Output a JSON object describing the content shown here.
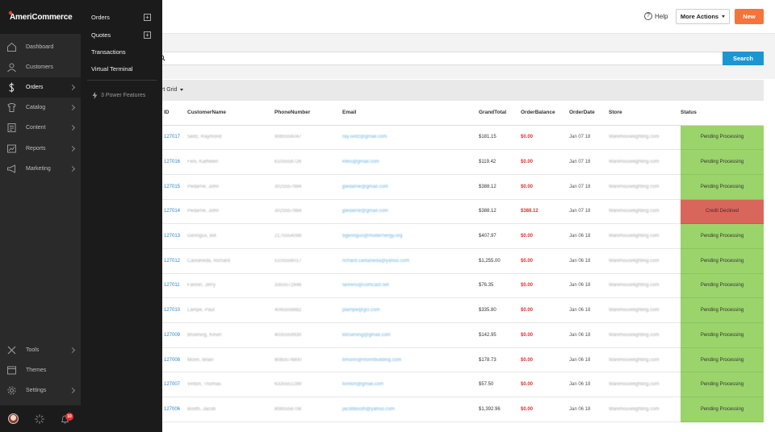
{
  "header": {
    "help_label": "Help",
    "help_glyph": "?",
    "more_actions_label": "More Actions",
    "new_label": "New"
  },
  "search": {
    "placeholder": "",
    "button_label": "Search"
  },
  "grid_bar": {
    "label": "rt Grid"
  },
  "table": {
    "columns": [
      "ID",
      "CustomerName",
      "PhoneNumber",
      "Email",
      "GrandTotal",
      "OrderBalance",
      "OrderDate",
      "Store",
      "Status"
    ],
    "rows": [
      {
        "id": "127017",
        "name": "Seitz, Raymond",
        "phone": "9085556047",
        "email": "ray.seitz@gmail.com",
        "grand_total": "$181.15",
        "balance": "$0.00",
        "date": "Jan 07 18",
        "store": "Warehouselighting.com",
        "status": "Pending Processing"
      },
      {
        "id": "127016",
        "name": "Fels, Kathleen",
        "phone": "6105558726",
        "email": "kfels@gmail.com",
        "grand_total": "$119.42",
        "balance": "$0.00",
        "date": "Jan 07 18",
        "store": "Warehouselighting.com",
        "status": "Pending Processing"
      },
      {
        "id": "127015",
        "name": "Pedarne, John",
        "phone": "3025557984",
        "email": "jpedarne@gmail.com",
        "grand_total": "$388.12",
        "balance": "$0.00",
        "date": "Jan 07 18",
        "store": "Warehouselighting.com",
        "status": "Pending Processing"
      },
      {
        "id": "127014",
        "name": "Pedarne, John",
        "phone": "3025557984",
        "email": "jpedarne@gmail.com",
        "grand_total": "$388.12",
        "balance": "$388.12",
        "date": "Jan 07 18",
        "store": "Warehouselighting.com",
        "status": "Credit Declined"
      },
      {
        "id": "127013",
        "name": "Geringus, Bill",
        "phone": "2175554098",
        "email": "bgeringus@modernergy.org",
        "grand_total": "$407.97",
        "balance": "$0.00",
        "date": "Jan 06 18",
        "store": "Warehouselighting.com",
        "status": "Pending Processing"
      },
      {
        "id": "127012",
        "name": "Castaneda, Richard",
        "phone": "5105556017",
        "email": "richard.castaneda@yahoo.com",
        "grand_total": "$1,255.00",
        "balance": "$0.00",
        "date": "Jan 06 18",
        "store": "Warehouselighting.com",
        "status": "Pending Processing"
      },
      {
        "id": "127011",
        "name": "Fannin, Jerry",
        "phone": "3355572846",
        "email": "fannins@comcast.net",
        "grand_total": "$76.35",
        "balance": "$0.00",
        "date": "Jan 06 18",
        "store": "Warehouselighting.com",
        "status": "Pending Processing"
      },
      {
        "id": "127010",
        "name": "Lampe, Paul",
        "phone": "4045558882",
        "email": "plampe@gci.com",
        "grand_total": "$335.80",
        "balance": "$0.00",
        "date": "Jan 06 18",
        "store": "Warehouselighting.com",
        "status": "Pending Processing"
      },
      {
        "id": "127009",
        "name": "Bruening, Kevin",
        "phone": "4035559930",
        "email": "kbruening@gmail.com",
        "grand_total": "$142.95",
        "balance": "$0.00",
        "date": "Jan 06 18",
        "store": "Warehouselighting.com",
        "status": "Pending Processing"
      },
      {
        "id": "127008",
        "name": "Morin, Brian",
        "phone": "8085574800",
        "email": "bmorin@morinbuilding.com",
        "grand_total": "$178.73",
        "balance": "$0.00",
        "date": "Jan 06 18",
        "store": "Warehouselighting.com",
        "status": "Pending Processing"
      },
      {
        "id": "127007",
        "name": "Vinton, Thomas",
        "phone": "6335551289",
        "email": "tvinton@gmail.com",
        "grand_total": "$57.50",
        "balance": "$0.00",
        "date": "Jan 06 18",
        "store": "Warehouselighting.com",
        "status": "Pending Processing"
      },
      {
        "id": "127006",
        "name": "Booth, Jacob",
        "phone": "8085558708",
        "email": "jacobbooth@yahoo.com",
        "grand_total": "$1,392.96",
        "balance": "$0.00",
        "date": "Jan 06 18",
        "store": "Warehouselighting.com",
        "status": "Pending Processing"
      }
    ]
  },
  "sidebar": {
    "logo": "AmeriCommerce",
    "items": [
      {
        "label": "Dashboard",
        "icon": "dashboard-icon"
      },
      {
        "label": "Customers",
        "icon": "customers-icon"
      },
      {
        "label": "Orders",
        "icon": "dollar-icon"
      },
      {
        "label": "Catalog",
        "icon": "catalog-icon"
      },
      {
        "label": "Content",
        "icon": "content-icon"
      },
      {
        "label": "Reports",
        "icon": "reports-icon"
      },
      {
        "label": "Marketing",
        "icon": "megaphone-icon"
      },
      {
        "label": "Tools",
        "icon": "tools-icon"
      },
      {
        "label": "Themes",
        "icon": "themes-icon"
      },
      {
        "label": "Settings",
        "icon": "gear-icon"
      }
    ],
    "notifications_count": "10"
  },
  "submenu": {
    "items": [
      {
        "label": "Orders"
      },
      {
        "label": "Quotes"
      },
      {
        "label": "Transactions"
      },
      {
        "label": "Virtual Terminal"
      }
    ],
    "plus_glyph": "+",
    "power_features": "3 Power Features"
  },
  "colors": {
    "sidebar": "#2a2a2a",
    "submenu": "#1b1b1b",
    "accent_orange": "#f4743b",
    "accent_blue": "#1c96d3",
    "status_pending": "#9ad46b",
    "status_declined": "#d9665a",
    "balance_red": "#e53030"
  }
}
